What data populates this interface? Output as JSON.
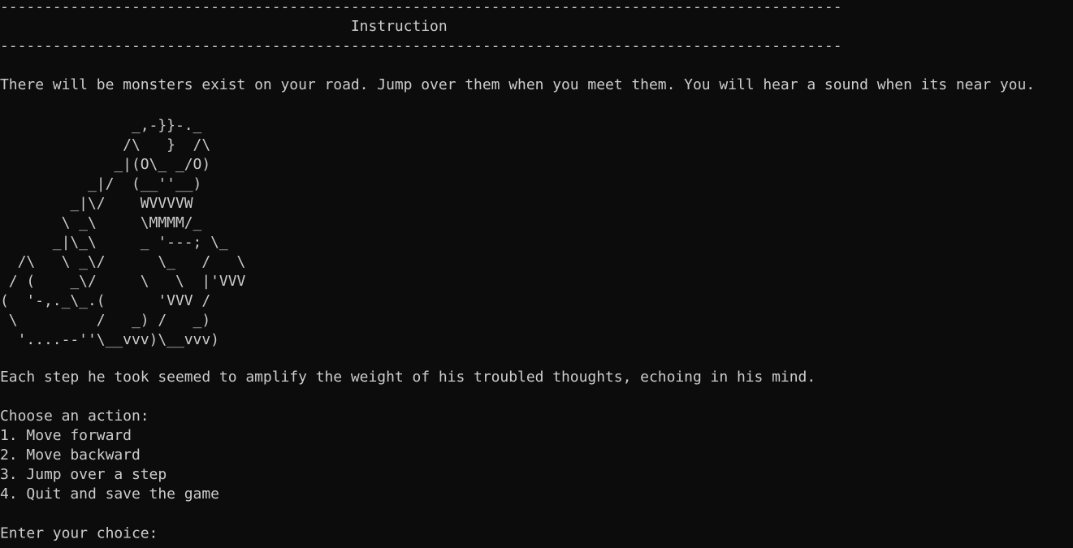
{
  "window": {
    "background": "#0c0c0c",
    "foreground": "#cccccc"
  },
  "header": {
    "rule_top": "------------------------------------------------------------------------------------------------",
    "title": "                                        Instruction",
    "rule_bottom": "------------------------------------------------------------------------------------------------"
  },
  "intro": "There will be monsters exist on your road. Jump over them when you meet them. You will hear a sound when its near you.",
  "ascii_art": "               _,-}}-._\n              /\\   }  /\\\n             _|(O\\_ _/O)\n          _|/  (__''__)\n        _|\\/    WVVVVW\n       \\ _\\     \\MMMM/_\n      _|\\_\\     _ '---; \\_\n  /\\   \\ _\\/      \\_   /   \\\n / (    _\\/     \\   \\  |'VVV\n(  '-,._\\_.(      'VVV /\n \\         /   _) /   _)\n  '....--''\\__vvv)\\__vvv)",
  "narration": "Each step he took seemed to amplify the weight of his troubled thoughts, echoing in his mind.",
  "menu": {
    "prompt": "Choose an action:",
    "options": [
      "1. Move forward",
      "2. Move backward",
      "3. Jump over a step",
      "4. Quit and save the game"
    ]
  },
  "input": {
    "prompt": "Enter your choice: ",
    "value": ""
  }
}
